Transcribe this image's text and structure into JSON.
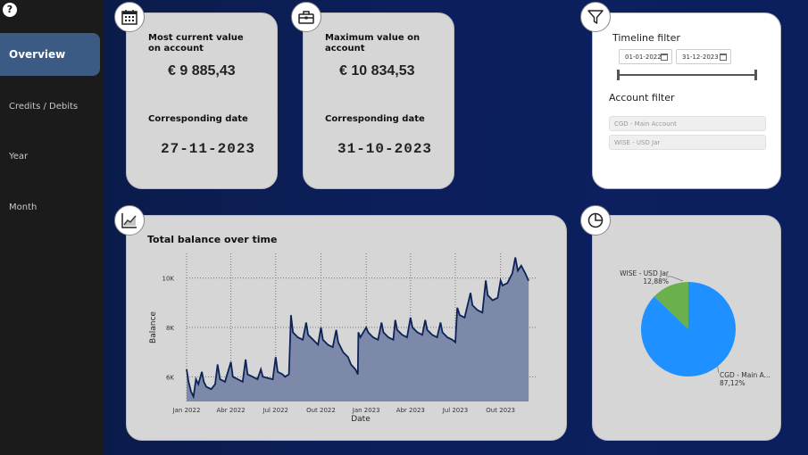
{
  "sidebar": {
    "help_symbol": "?",
    "items": [
      {
        "label": "Overview",
        "active": true
      },
      {
        "label": "Credits / Debits",
        "active": false
      },
      {
        "label": "Year",
        "active": false
      },
      {
        "label": "Month",
        "active": false
      }
    ]
  },
  "kpi_current": {
    "icon": "calendar-icon",
    "label": "Most current value on account",
    "value": "€ 9 885,43",
    "date_label": "Corresponding date",
    "date_value": "27-11-2023"
  },
  "kpi_max": {
    "icon": "toolbox-icon",
    "label": "Maximum value on account",
    "value": "€ 10 834,53",
    "date_label": "Corresponding date",
    "date_value": "31-10-2023"
  },
  "filters": {
    "icon": "filter-icon",
    "timeline_title": "Timeline filter",
    "date_from": "01-01-2022",
    "date_to": "31-12-2023",
    "timeline_level": 1.0,
    "account_title": "Account filter",
    "accounts": [
      "CGD - Main Account",
      "WISE - USD Jar"
    ]
  },
  "balance_chart": {
    "icon": "line-chart-icon",
    "chart_data": {
      "type": "area",
      "title": "Total balance over time",
      "xlabel": "Date",
      "ylabel": "Balance",
      "x_ticks": [
        "Jan 2022",
        "Abr 2022",
        "Jul 2022",
        "Out 2022",
        "Jan 2023",
        "Abr 2023",
        "Jul 2023",
        "Out 2023"
      ],
      "y_ticks": [
        "6K",
        "8K",
        "10K"
      ],
      "ylim": [
        5000,
        11000
      ],
      "grid": true,
      "series": [
        {
          "points": [
            [
              "2022-01-01",
              6300
            ],
            [
              "2022-01-05",
              5800
            ],
            [
              "2022-01-10",
              5400
            ],
            [
              "2022-01-15",
              5200
            ],
            [
              "2022-01-20",
              5900
            ],
            [
              "2022-01-25",
              5700
            ],
            [
              "2022-02-01",
              6200
            ],
            [
              "2022-02-05",
              5800
            ],
            [
              "2022-02-10",
              5600
            ],
            [
              "2022-02-20",
              5500
            ],
            [
              "2022-02-28",
              5700
            ],
            [
              "2022-03-05",
              6500
            ],
            [
              "2022-03-10",
              5900
            ],
            [
              "2022-03-20",
              5800
            ],
            [
              "2022-04-01",
              6600
            ],
            [
              "2022-04-05",
              6000
            ],
            [
              "2022-04-15",
              5900
            ],
            [
              "2022-04-25",
              5800
            ],
            [
              "2022-05-01",
              6700
            ],
            [
              "2022-05-05",
              6100
            ],
            [
              "2022-05-15",
              6000
            ],
            [
              "2022-05-25",
              5900
            ],
            [
              "2022-06-01",
              6300
            ],
            [
              "2022-06-05",
              6000
            ],
            [
              "2022-06-15",
              5950
            ],
            [
              "2022-06-25",
              5900
            ],
            [
              "2022-07-01",
              6800
            ],
            [
              "2022-07-05",
              6200
            ],
            [
              "2022-07-15",
              6100
            ],
            [
              "2022-07-20",
              6000
            ],
            [
              "2022-07-28",
              6100
            ],
            [
              "2022-08-01",
              8500
            ],
            [
              "2022-08-05",
              7800
            ],
            [
              "2022-08-15",
              7600
            ],
            [
              "2022-08-25",
              7500
            ],
            [
              "2022-09-01",
              8200
            ],
            [
              "2022-09-05",
              7700
            ],
            [
              "2022-09-15",
              7500
            ],
            [
              "2022-09-25",
              7300
            ],
            [
              "2022-10-01",
              8000
            ],
            [
              "2022-10-05",
              7500
            ],
            [
              "2022-10-15",
              7300
            ],
            [
              "2022-10-25",
              7200
            ],
            [
              "2022-11-01",
              7900
            ],
            [
              "2022-11-05",
              7400
            ],
            [
              "2022-11-15",
              7000
            ],
            [
              "2022-11-25",
              6800
            ],
            [
              "2022-12-01",
              6500
            ],
            [
              "2022-12-10",
              6300
            ],
            [
              "2022-12-15",
              6100
            ],
            [
              "2022-12-16",
              7800
            ],
            [
              "2022-12-20",
              7600
            ],
            [
              "2023-01-01",
              8000
            ],
            [
              "2023-01-05",
              7800
            ],
            [
              "2023-01-15",
              7600
            ],
            [
              "2023-01-25",
              7500
            ],
            [
              "2023-02-01",
              8200
            ],
            [
              "2023-02-05",
              7800
            ],
            [
              "2023-02-15",
              7600
            ],
            [
              "2023-02-25",
              7500
            ],
            [
              "2023-03-01",
              8300
            ],
            [
              "2023-03-05",
              7900
            ],
            [
              "2023-03-15",
              7700
            ],
            [
              "2023-03-25",
              7600
            ],
            [
              "2023-04-01",
              8400
            ],
            [
              "2023-04-05",
              8000
            ],
            [
              "2023-04-15",
              7800
            ],
            [
              "2023-04-25",
              7700
            ],
            [
              "2023-05-01",
              8300
            ],
            [
              "2023-05-05",
              7900
            ],
            [
              "2023-05-15",
              7700
            ],
            [
              "2023-05-25",
              7600
            ],
            [
              "2023-06-01",
              8200
            ],
            [
              "2023-06-05",
              7800
            ],
            [
              "2023-06-15",
              7600
            ],
            [
              "2023-06-25",
              7500
            ],
            [
              "2023-07-01",
              7400
            ],
            [
              "2023-07-05",
              8800
            ],
            [
              "2023-07-10",
              8500
            ],
            [
              "2023-07-20",
              8400
            ],
            [
              "2023-08-01",
              9400
            ],
            [
              "2023-08-05",
              8900
            ],
            [
              "2023-08-15",
              8700
            ],
            [
              "2023-08-25",
              8600
            ],
            [
              "2023-09-01",
              9900
            ],
            [
              "2023-09-05",
              9300
            ],
            [
              "2023-09-15",
              9100
            ],
            [
              "2023-09-25",
              9200
            ],
            [
              "2023-10-01",
              9900
            ],
            [
              "2023-10-05",
              9700
            ],
            [
              "2023-10-15",
              9800
            ],
            [
              "2023-10-25",
              10200
            ],
            [
              "2023-10-31",
              10834
            ],
            [
              "2023-11-05",
              10300
            ],
            [
              "2023-11-12",
              10500
            ],
            [
              "2023-11-20",
              10200
            ],
            [
              "2023-11-27",
              9885
            ]
          ]
        }
      ]
    }
  },
  "pie_chart": {
    "icon": "pie-chart-icon",
    "chart_data": {
      "type": "pie",
      "slices": [
        {
          "label": "CGD - Main A...",
          "value_label": "87,12%",
          "value": 87.12,
          "color": "#1e90ff"
        },
        {
          "label": "WISE - USD Jar",
          "value_label": "12,88%",
          "value": 12.88,
          "color": "#6ab04c"
        }
      ]
    }
  },
  "colors": {
    "accent_active": "#3b5a84",
    "area_fill": "#7d89a8",
    "line": "#0d2357"
  }
}
